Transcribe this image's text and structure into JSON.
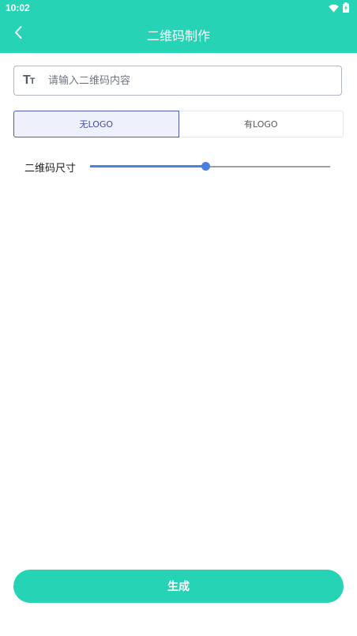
{
  "status_bar": {
    "time": "10:02",
    "wifi_icon": "wifi-icon",
    "battery_icon": "battery-charging-icon"
  },
  "app_bar": {
    "title": "二维码制作",
    "back_icon": "chevron-left-icon"
  },
  "content_input": {
    "icon": "text-size-icon",
    "icon_text": "Tт",
    "placeholder": "请输入二维码内容",
    "value": ""
  },
  "logo_toggle": {
    "options": [
      {
        "label": "无LOGO",
        "selected": true
      },
      {
        "label": "有LOGO",
        "selected": false
      }
    ]
  },
  "size_slider": {
    "label": "二维码尺寸",
    "value_fraction": 0.48
  },
  "generate_button": {
    "label": "生成"
  },
  "colors": {
    "primary": "#26d3b5",
    "accent": "#4a80e6",
    "toggle_active_border": "#4d5db5",
    "toggle_active_bg": "#eef0fb"
  }
}
